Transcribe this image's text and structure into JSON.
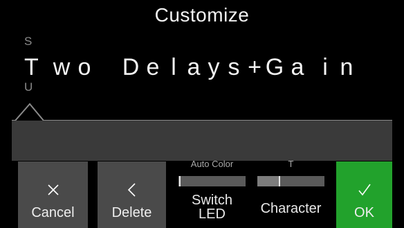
{
  "header": {
    "title": "Customize"
  },
  "editor": {
    "char_above": "S",
    "char_below": "U",
    "name_chars": [
      "T",
      "w",
      "o",
      "D",
      "e",
      "l",
      "a",
      "y",
      "s",
      "+",
      "G",
      "a",
      "i",
      "n"
    ]
  },
  "controls": {
    "cancel": {
      "icon": "close-icon",
      "label": "Cancel"
    },
    "delete": {
      "icon": "chevron-left-icon",
      "label": "Delete"
    },
    "switch_led": {
      "header": "Auto Color",
      "label": "Switch LED",
      "level": 0.02
    },
    "character": {
      "header": "T",
      "label": "Character",
      "level": 0.33
    },
    "ok": {
      "icon": "check-icon",
      "label": "OK",
      "color": "#22a22c"
    }
  }
}
